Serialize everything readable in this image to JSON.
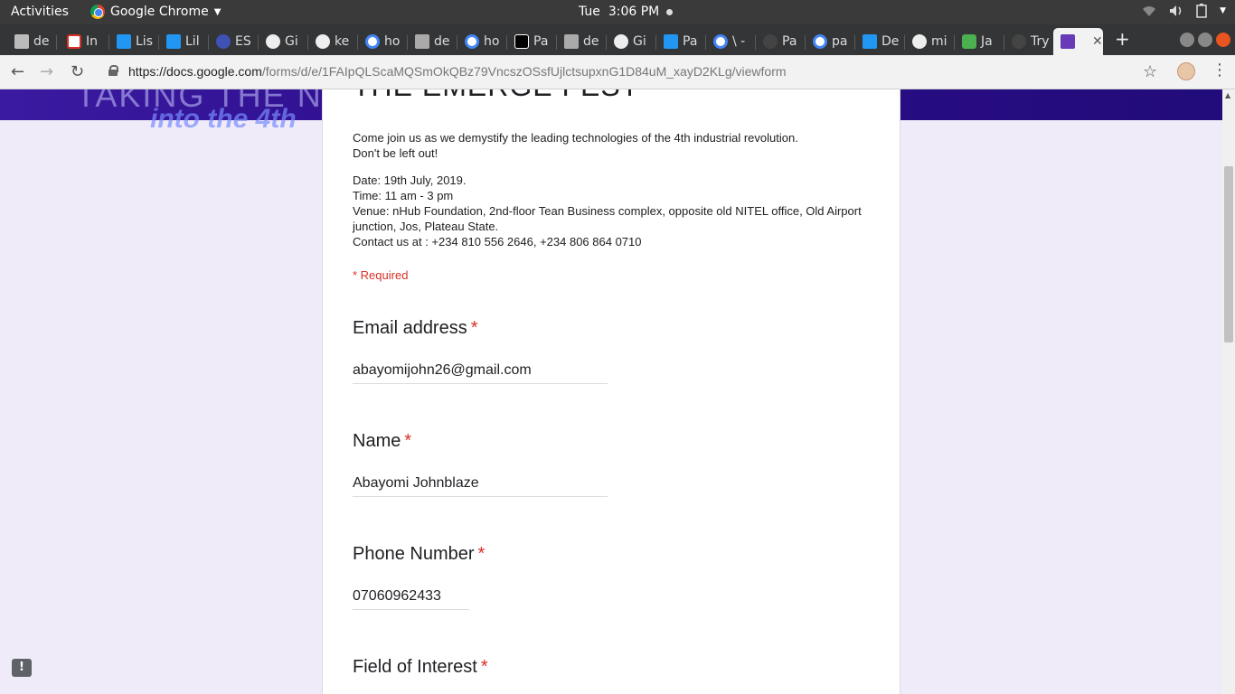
{
  "topbar": {
    "activities": "Activities",
    "app_name": "Google Chrome",
    "day": "Tue",
    "time": "3:06 PM"
  },
  "tabs": [
    {
      "label": "de",
      "icon": "stack-icon"
    },
    {
      "label": "In",
      "icon": "gmail-icon"
    },
    {
      "label": "Lis",
      "icon": "docs-icon"
    },
    {
      "label": "Lil",
      "icon": "docs-icon"
    },
    {
      "label": "ES",
      "icon": "shield-icon"
    },
    {
      "label": "Gi",
      "icon": "github-icon"
    },
    {
      "label": "ke",
      "icon": "github-icon"
    },
    {
      "label": "ho",
      "icon": "google-icon"
    },
    {
      "label": "de",
      "icon": "docs-gray-icon"
    },
    {
      "label": "ho",
      "icon": "google-icon"
    },
    {
      "label": "Pa",
      "icon": "medium-icon"
    },
    {
      "label": "de",
      "icon": "docs-gray-icon"
    },
    {
      "label": "Gi",
      "icon": "github-icon"
    },
    {
      "label": "Pa",
      "icon": "docs-icon"
    },
    {
      "label": "\\ -",
      "icon": "google-icon"
    },
    {
      "label": "Pa",
      "icon": "dark-icon"
    },
    {
      "label": "pa",
      "icon": "google-icon"
    },
    {
      "label": "De",
      "icon": "docs-icon"
    },
    {
      "label": "mi",
      "icon": "github-icon"
    },
    {
      "label": "Ja",
      "icon": "green-icon"
    },
    {
      "label": "Try",
      "icon": "dark-icon"
    }
  ],
  "active_tab": {
    "icon": "forms-icon",
    "close": "✕"
  },
  "address": {
    "host": "https://docs.google.com",
    "path": "/forms/d/e/1FAIpQLScaMQSmOkQBz79VncszOSsfUjlctsupxnG1D84uM_xayD2KLg/viewform"
  },
  "banner": {
    "text": "TAKING THE N",
    "sub": "into the 4th"
  },
  "form": {
    "title": "THE EMERGE FEST",
    "intro_1": "Come join us as we demystify the leading technologies of the 4th industrial revolution.",
    "intro_2": "Don't be left out!",
    "date": "Date: 19th July, 2019.",
    "time": "Time: 11 am - 3 pm",
    "venue_1": "Venue: nHub Foundation, 2nd-floor Tean Business complex, opposite old NITEL office, Old Airport",
    "venue_2": "junction, Jos,  Plateau State.",
    "contact": "Contact us at : +234 810 556 2646, +234 806 864 0710",
    "required_note": "* Required",
    "asterisk": "*",
    "questions": [
      {
        "label": "Email address",
        "value": "abayomijohn26@gmail.com"
      },
      {
        "label": "Name",
        "value": "Abayomi Johnblaze"
      },
      {
        "label": "Phone Number",
        "value": "07060962433"
      },
      {
        "label": "Field of Interest",
        "value": ""
      }
    ]
  },
  "feedback_label": "!"
}
